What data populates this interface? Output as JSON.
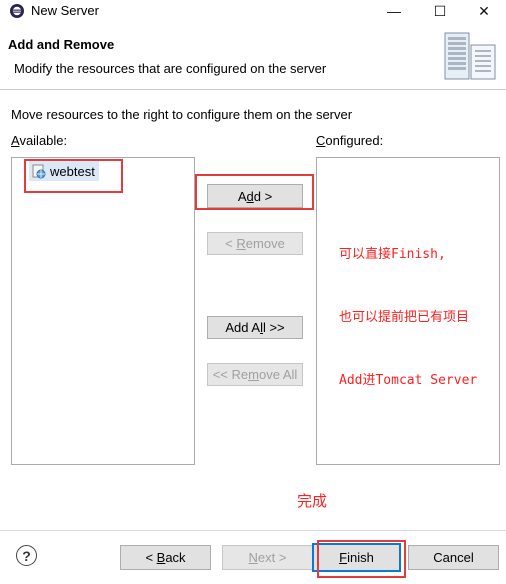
{
  "window": {
    "title": "New Server",
    "controls": {
      "minimize": "—",
      "maximize": "☐",
      "close": "✕"
    }
  },
  "header": {
    "title": "Add and Remove",
    "description": "Modify the resources that are configured on the server",
    "icon": "server-icon"
  },
  "body": {
    "instruction": "Move resources to the right to configure them on the server",
    "available_label": "Available:",
    "configured_label": "Configured:",
    "available_items": [
      "webtest"
    ],
    "configured_items": []
  },
  "buttons": {
    "add": {
      "label": "Add >",
      "enabled": true
    },
    "remove": {
      "label": "< Remove",
      "enabled": false
    },
    "add_all": {
      "label": "Add All >>",
      "enabled": true
    },
    "remove_all": {
      "label": "<< Remove All",
      "enabled": false
    }
  },
  "footer": {
    "help": "?",
    "back": {
      "label": "< Back",
      "enabled": true
    },
    "next": {
      "label": "Next >",
      "enabled": false
    },
    "finish": {
      "label": "Finish",
      "enabled": true,
      "default": true
    },
    "cancel": {
      "label": "Cancel",
      "enabled": true
    }
  },
  "annotations": {
    "note_lines": [
      "可以直接Finish,",
      "也可以提前把已有项目",
      "Add进Tomcat Server"
    ],
    "done": "完成",
    "color": "#ff2020"
  }
}
